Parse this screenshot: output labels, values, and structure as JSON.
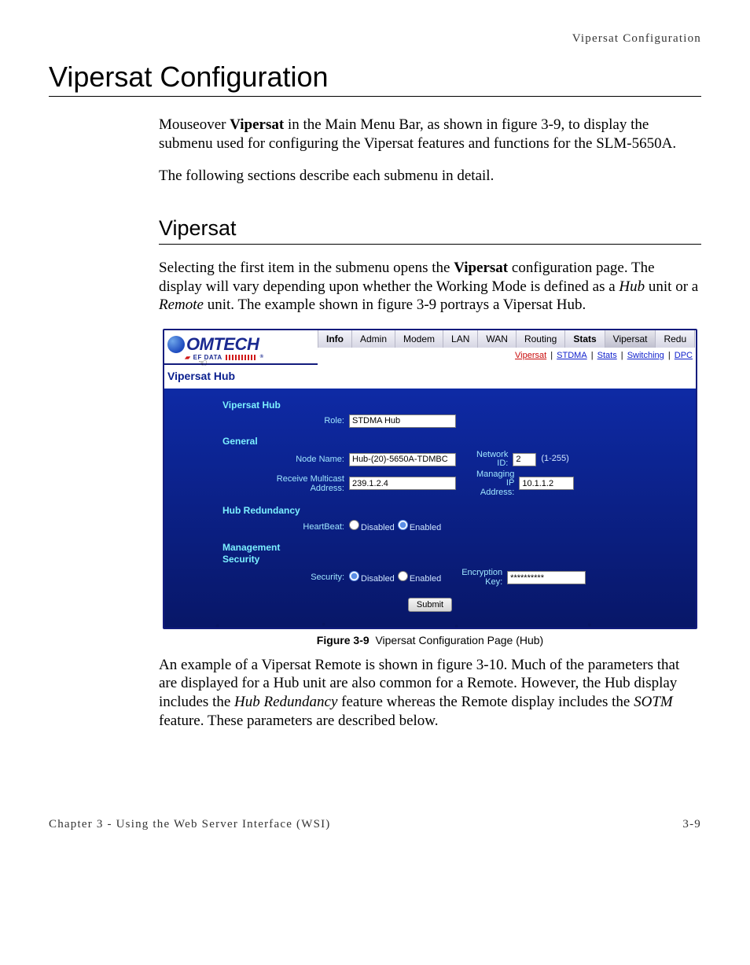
{
  "running_head": "Vipersat Configuration",
  "h1": "Vipersat Configuration",
  "intro_p1_pre": "Mouseover ",
  "intro_p1_bold": "Vipersat",
  "intro_p1_post": " in the Main Menu Bar, as shown in figure 3-9, to display the submenu used for configuring the Vipersat features and functions for the SLM-5650A.",
  "intro_p2": "The following sections describe each submenu in detail.",
  "h2": "Vipersat",
  "sub_p1_a": "Selecting the first item in the submenu opens the ",
  "sub_p1_bold": "Vipersat",
  "sub_p1_b": " configuration page. The display will vary depending upon whether the Working Mode is defined as a ",
  "sub_p1_i1": "Hub",
  "sub_p1_c": " unit or a ",
  "sub_p1_i2": "Remote",
  "sub_p1_d": " unit. The example shown in figure 3-9 portrays a Vipersat Hub.",
  "figure": {
    "num": "Figure 3-9",
    "caption": "Vipersat Configuration Page (Hub)"
  },
  "after_p_a": "An example of a Vipersat Remote is shown in figure 3-10. Much of the parameters that are displayed for a Hub unit are also common for a Remote. However, the Hub display includes the ",
  "after_p_i1": "Hub Redundancy",
  "after_p_b": " feature whereas the Remote display includes the ",
  "after_p_i2": "SOTM",
  "after_p_c": " feature. These parameters are described below.",
  "footer_left": "Chapter 3 - Using the Web Server Interface (WSI)",
  "footer_right": "3-9",
  "app": {
    "logo": {
      "name_a": "C",
      "name_b": "OMTECH",
      "sub": "EF DATA",
      "reg": "®"
    },
    "menu": [
      "Info",
      "Admin",
      "Modem",
      "LAN",
      "WAN",
      "Routing",
      "Stats",
      "Vipersat",
      "Redu"
    ],
    "subnav": [
      "Vipersat",
      "STDMA",
      "Stats",
      "Switching",
      "DPC"
    ],
    "page_title": "Vipersat Hub",
    "groups": {
      "vipersat_hub": {
        "title": "Vipersat Hub",
        "role_label": "Role:",
        "role_value": "STDMA Hub"
      },
      "general": {
        "title": "General",
        "node_name_label": "Node Name:",
        "node_name_value": "Hub-(20)-5650A-TDMBC",
        "network_id_label": "Network\nID:",
        "network_id_value": "2",
        "network_id_hint": "(1-255)",
        "recv_mcast_label": "Receive Multicast\nAddress:",
        "recv_mcast_value": "239.1.2.4",
        "managing_ip_label": "Managing\nIP\nAddress:",
        "managing_ip_value": "10.1.1.2"
      },
      "hub_redundancy": {
        "title": "Hub Redundancy",
        "heartbeat_label": "HeartBeat:",
        "disabled": "Disabled",
        "enabled": "Enabled"
      },
      "mgmt_security": {
        "title": "Management\nSecurity",
        "security_label": "Security:",
        "disabled": "Disabled",
        "enabled": "Enabled",
        "enc_key_label": "Encryption\nKey:",
        "enc_key_value": "**********"
      }
    },
    "submit": "Submit"
  }
}
